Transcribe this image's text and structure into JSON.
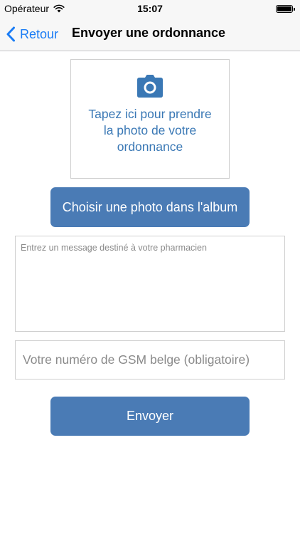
{
  "status_bar": {
    "carrier": "Opérateur",
    "time": "15:07",
    "wifi_icon": "wifi-icon",
    "battery_icon": "battery-icon"
  },
  "nav": {
    "back_label": "Retour",
    "back_icon": "chevron-left-icon",
    "title": "Envoyer une ordonnance",
    "accent_color": "#1a7cf5"
  },
  "photo_box": {
    "icon": "camera-icon",
    "text": "Tapez ici pour prendre\nla photo de votre\nordonnance",
    "text_color": "#3a78b5"
  },
  "album_button": {
    "label": "Choisir une photo dans l'album"
  },
  "message": {
    "value": "",
    "placeholder": "Entrez un message destiné à votre pharmacien"
  },
  "phone": {
    "value": "",
    "placeholder": "Votre numéro de GSM belge (obligatoire)"
  },
  "send_button": {
    "label": "Envoyer"
  },
  "colors": {
    "button_bg": "#4a7bb5",
    "button_text": "#ffffff",
    "bar_bg": "#f7f7f7"
  }
}
